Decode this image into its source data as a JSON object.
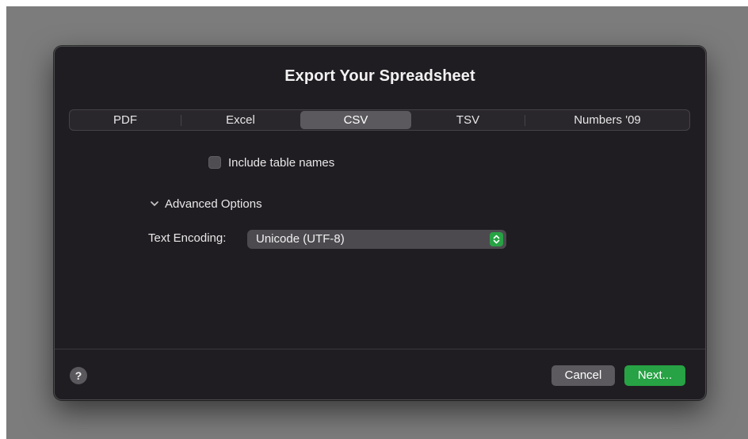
{
  "dialog": {
    "title": "Export Your Spreadsheet",
    "tabs": [
      {
        "label": "PDF",
        "selected": false
      },
      {
        "label": "Excel",
        "selected": false
      },
      {
        "label": "CSV",
        "selected": true
      },
      {
        "label": "TSV",
        "selected": false
      },
      {
        "label": "Numbers '09",
        "selected": false
      }
    ],
    "include_table_names": {
      "label": "Include table names",
      "checked": false
    },
    "advanced": {
      "label": "Advanced Options",
      "expanded": true
    },
    "text_encoding": {
      "label": "Text Encoding:",
      "value": "Unicode (UTF-8)"
    },
    "help": {
      "glyph": "?",
      "icon": "help-icon"
    },
    "buttons": {
      "cancel": "Cancel",
      "next": "Next..."
    }
  },
  "colors": {
    "accent": "#27a244",
    "dialog_bg": "#201d22",
    "backdrop": "#7c7c7c"
  }
}
